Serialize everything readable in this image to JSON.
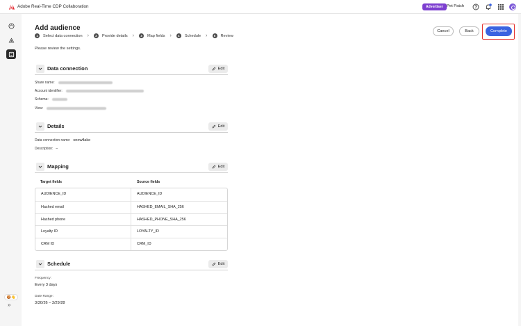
{
  "app": {
    "title": "Adobe Real-Time CDP Collaboration",
    "badge": "Advertiser",
    "org": "Pet Patch",
    "notification_count": "1"
  },
  "rail": {
    "items": [
      "home-icon",
      "audience-icon",
      "connections-icon"
    ],
    "bottom_icons": "🍪👋"
  },
  "page": {
    "title": "Add audience",
    "review_note": "Please review the settings."
  },
  "steps": [
    {
      "num": "1",
      "label": "Select data connection"
    },
    {
      "num": "2",
      "label": "Provide details"
    },
    {
      "num": "3",
      "label": "Map fields"
    },
    {
      "num": "4",
      "label": "Schedule"
    },
    {
      "num": "5",
      "label": "Review"
    }
  ],
  "actions": {
    "cancel": "Cancel",
    "back": "Back",
    "complete": "Complete"
  },
  "edit_label": "Edit",
  "data_connection": {
    "title": "Data connection",
    "share_name_label": "Share name:",
    "account_label": "Account identifier:",
    "schema_label": "Schema:",
    "view_label": "View:"
  },
  "details": {
    "title": "Details",
    "name_label": "Data connection name:",
    "name_value": "snowflake",
    "description_label": "Description:",
    "description_value": "–"
  },
  "mapping": {
    "title": "Mapping",
    "col_target": "Target fields",
    "col_source": "Source fields",
    "rows": [
      {
        "target": "AUDIENCE_ID",
        "source": "AUDIENCE_ID"
      },
      {
        "target": "Hashed email",
        "source": "HASHED_EMAIL_SHA_256"
      },
      {
        "target": "Hashed phone",
        "source": "HASHED_PHONE_SHA_256"
      },
      {
        "target": "Loyalty ID",
        "source": "LOYALTY_ID"
      },
      {
        "target": "CRM ID",
        "source": "CRM_ID"
      }
    ]
  },
  "schedule": {
    "title": "Schedule",
    "frequency_label": "Frequency:",
    "frequency_value": "Every 3 days",
    "date_label": "Date Range:",
    "date_value": "3/30/26 – 3/29/28"
  },
  "colors": {
    "accent": "#3b63e0",
    "badge": "#7d3fd0",
    "highlight": "#e53935",
    "logo": "#e41c24"
  }
}
